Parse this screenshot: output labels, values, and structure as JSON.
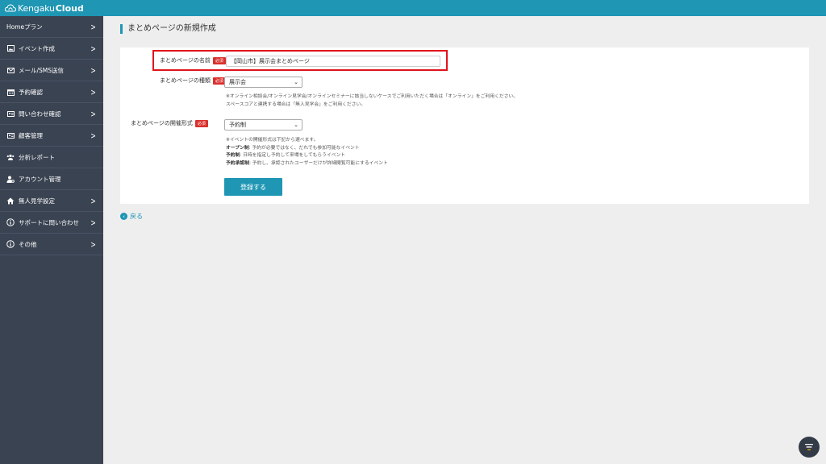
{
  "app": {
    "brand_part1": "Kengaku",
    "brand_part2": "Cloud"
  },
  "sidebar": {
    "items": [
      {
        "label": "Homeプラン",
        "icon": "none",
        "chevron": true
      },
      {
        "label": "イベント作成",
        "icon": "image-icon",
        "chevron": true
      },
      {
        "label": "メール/SMS送信",
        "icon": "mail-icon",
        "chevron": true
      },
      {
        "label": "予約確認",
        "icon": "calendar-icon",
        "chevron": true
      },
      {
        "label": "問い合わせ確認",
        "icon": "id-card-icon",
        "chevron": true
      },
      {
        "label": "顧客管理",
        "icon": "id-card-icon",
        "chevron": true
      },
      {
        "label": "分析レポート",
        "icon": "users-icon",
        "chevron": false
      },
      {
        "label": "アカウント管理",
        "icon": "user-gear-icon",
        "chevron": false
      },
      {
        "label": "無人見学設定",
        "icon": "home-icon",
        "chevron": true
      },
      {
        "label": "サポートに問い合わせ",
        "icon": "info-icon",
        "chevron": true
      },
      {
        "label": "その他",
        "icon": "info-icon",
        "chevron": true
      }
    ]
  },
  "page": {
    "title": "まとめページの新規作成"
  },
  "form": {
    "required_badge": "必須",
    "name": {
      "label": "まとめページの名前",
      "value": "【岡山市】展示会まとめページ"
    },
    "type": {
      "label": "まとめページの種類",
      "selected": "展示会",
      "help1": "※オンライン相談会/オンライン見学会/オンラインセミナーに該当しないケースでご利用いただく場合は「オンライン」をご利用ください。",
      "help2": "スペースコアと連携する場合は「無人見学会」をご利用ください。"
    },
    "format": {
      "label": "まとめページの開催形式",
      "selected": "予約制",
      "help_intro": "※イベントの開催形式は下記から選べます。",
      "options_help": [
        {
          "term": "オープン制",
          "desc": ": 予約が必要ではなく、だれでも参加可能なイベント"
        },
        {
          "term": "予約制",
          "desc": ": 日時を指定し予約して来場をしてもらうイベント"
        },
        {
          "term": "予約承認制",
          "desc": ": 予約し、承認されたユーザーだけが詳細閲覧可能にするイベント"
        }
      ]
    },
    "submit_label": "登録する"
  },
  "back": {
    "label": "戻る"
  },
  "colors": {
    "accent": "#1e96b4",
    "sidebar_bg": "#3a4352",
    "required": "#d9302c",
    "highlight": "#e0141c"
  }
}
